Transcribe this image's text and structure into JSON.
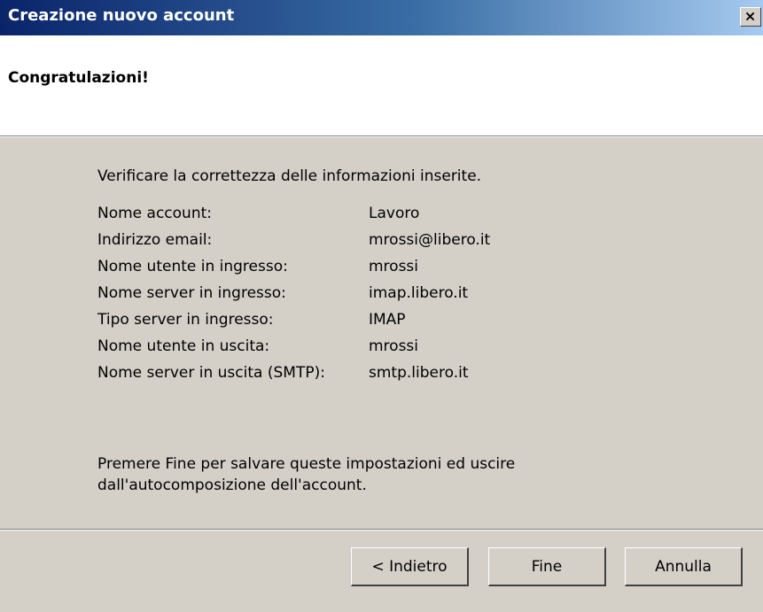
{
  "window": {
    "title": "Creazione nuovo account",
    "close_symbol": "×"
  },
  "header": {
    "title": "Congratulazioni!"
  },
  "content": {
    "intro": "Verificare la correttezza delle informazioni inserite.",
    "rows": [
      {
        "label": "Nome account:",
        "value": "Lavoro"
      },
      {
        "label": "Indirizzo email:",
        "value": "mrossi@libero.it"
      },
      {
        "label": "Nome utente in ingresso:",
        "value": "mrossi"
      },
      {
        "label": "Nome server in ingresso:",
        "value": "imap.libero.it"
      },
      {
        "label": "Tipo server in ingresso:",
        "value": "IMAP"
      },
      {
        "label": "Nome utente in uscita:",
        "value": "mrossi"
      },
      {
        "label": "Nome server in uscita (SMTP):",
        "value": "smtp.libero.it"
      }
    ],
    "note_line1": "Premere Fine per salvare queste impostazioni ed uscire",
    "note_line2": "dall'autocomposizione dell'account."
  },
  "buttons": {
    "back": "< Indietro",
    "finish": "Fine",
    "cancel": "Annulla"
  },
  "colors": {
    "titlebar_start": "#0a246a",
    "titlebar_end": "#a6caf0",
    "dialog_bg": "#d4d0c8",
    "header_bg": "#ffffff"
  }
}
